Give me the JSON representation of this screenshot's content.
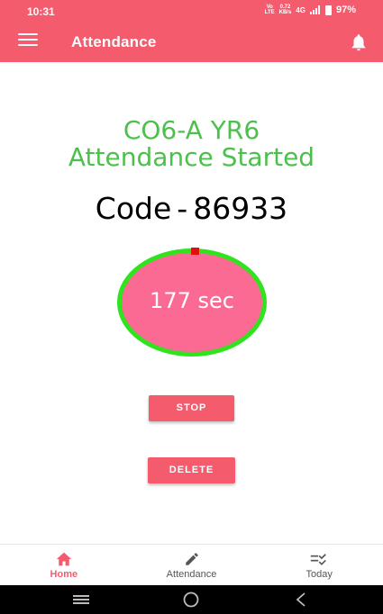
{
  "status_bar": {
    "time": "10:31",
    "network_top": "Vo",
    "network_bottom": "LTE",
    "speed_top": "0.72",
    "speed_bottom": "KB/s",
    "network_type": "4G",
    "battery": "97%"
  },
  "app_bar": {
    "title": "Attendance",
    "menu_icon": "hamburger-menu-icon",
    "notification_icon": "bell-icon"
  },
  "main": {
    "class_line": "CO6-A YR6",
    "status_line": "Attendance Started",
    "code_label": "Code",
    "code_separator": "-",
    "code_value": "86933",
    "timer_text": "177 sec",
    "stop_label": "STOP",
    "delete_label": "DELETE"
  },
  "bottom_nav": {
    "items": [
      {
        "label": "Home",
        "icon": "home-icon",
        "active": true
      },
      {
        "label": "Attendance",
        "icon": "pencil-icon",
        "active": false
      },
      {
        "label": "Today",
        "icon": "checklist-icon",
        "active": false
      }
    ]
  },
  "colors": {
    "primary": "#f45b6d",
    "heading_green": "#4cc04c",
    "timer_fill": "#fb6a93",
    "timer_ring": "#2fe31f",
    "timer_marker": "#e01010"
  }
}
